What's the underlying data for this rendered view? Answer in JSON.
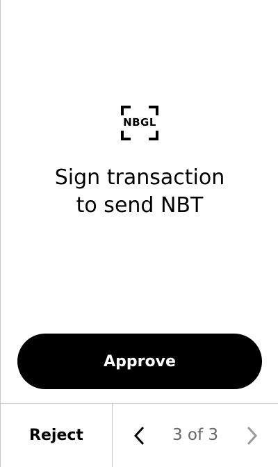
{
  "logo": {
    "text": "NBGL",
    "icon": "nbgl-logo-icon"
  },
  "review": {
    "title_line1": "Sign transaction",
    "title_line2": "to send NBT"
  },
  "actions": {
    "approve_label": "Approve",
    "reject_label": "Reject"
  },
  "navigation": {
    "page_indicator": "3 of 3",
    "prev_icon": "chevron-left-icon",
    "next_icon": "chevron-right-icon",
    "next_enabled": false
  },
  "colors": {
    "primary": "#000000",
    "background": "#ffffff",
    "divider": "#c8c8c8",
    "muted_text": "#666666",
    "disabled_icon": "#9a9a9a"
  }
}
